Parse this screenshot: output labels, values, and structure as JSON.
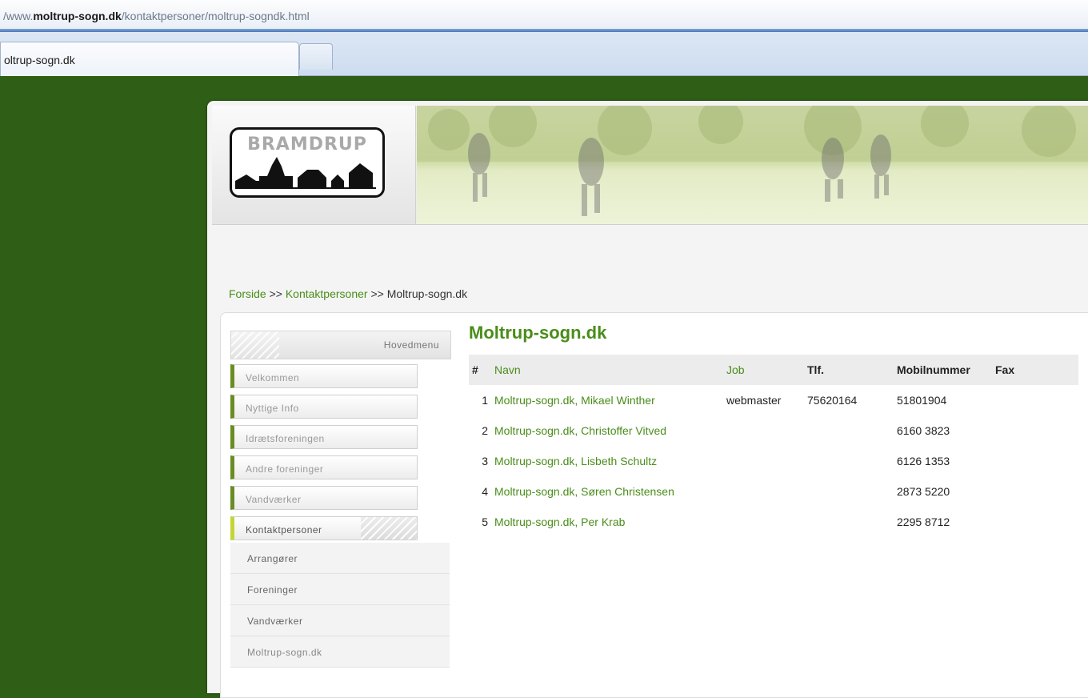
{
  "browser": {
    "url_prefix": "/www.",
    "url_host": "moltrup-sogn.dk",
    "url_path": "/kontaktpersoner/moltrup-sogndk.html",
    "tab_title": "oltrup-sogn.dk"
  },
  "logo": {
    "text": "BRAMDRUP"
  },
  "breadcrumb": {
    "home": "Forside",
    "sep1": " >> ",
    "section": "Kontaktpersoner",
    "sep2": " >> ",
    "current": "Moltrup-sogn.dk"
  },
  "menu": {
    "heading": "Hovedmenu",
    "items": [
      {
        "label": "Velkommen"
      },
      {
        "label": "Nyttige Info"
      },
      {
        "label": "Idrætsforeningen"
      },
      {
        "label": "Andre foreninger"
      },
      {
        "label": "Vandværker"
      },
      {
        "label": "Kontaktpersoner"
      }
    ],
    "subitems": [
      {
        "label": "Arrangører"
      },
      {
        "label": "Foreninger"
      },
      {
        "label": "Vandværker"
      },
      {
        "label": "Moltrup-sogn.dk"
      }
    ]
  },
  "main": {
    "title": "Moltrup-sogn.dk",
    "columns": {
      "num": "#",
      "name": "Navn",
      "job": "Job",
      "phone": "Tlf.",
      "mobile": "Mobilnummer",
      "fax": "Fax"
    },
    "rows": [
      {
        "num": "1",
        "name": "Moltrup-sogn.dk, Mikael Winther",
        "job": "webmaster",
        "phone": "75620164",
        "mobile": "51801904",
        "fax": ""
      },
      {
        "num": "2",
        "name": "Moltrup-sogn.dk, Christoffer Vitved",
        "job": "",
        "phone": "",
        "mobile": "6160 3823",
        "fax": ""
      },
      {
        "num": "3",
        "name": "Moltrup-sogn.dk, Lisbeth Schultz",
        "job": "",
        "phone": "",
        "mobile": "6126 1353",
        "fax": ""
      },
      {
        "num": "4",
        "name": "Moltrup-sogn.dk, Søren Christensen",
        "job": "",
        "phone": "",
        "mobile": "2873 5220",
        "fax": ""
      },
      {
        "num": "5",
        "name": "Moltrup-sogn.dk, Per Krab",
        "job": "",
        "phone": "",
        "mobile": "2295 8712",
        "fax": ""
      }
    ]
  }
}
